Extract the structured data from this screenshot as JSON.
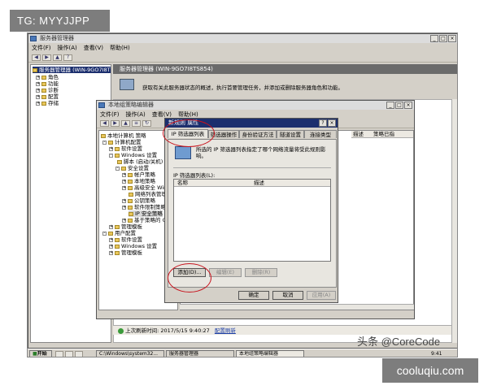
{
  "watermarks": {
    "tg": "TG: MYYJJPP",
    "toutiao": "头条 @CoreCode",
    "site": "cooluqiu.com"
  },
  "server_manager": {
    "title": "服务器管理器",
    "menu": [
      "文件(F)",
      "操作(A)",
      "查看(V)",
      "帮助(H)"
    ],
    "tree": [
      "服务器管理器 (WIN-9GO7I8TS854)",
      "角色",
      "功能",
      "诊断",
      "配置",
      "存储"
    ],
    "header": "服务器管理器 (WIN-9GO7I8TS854)",
    "desc": "获取有关此服务器状态的概述，执行首要管理任务，并添加或删除服务器角色和功能。",
    "status": "上次刷新时间: 2017/5/15 9:40:27",
    "refresh_link": "配置刷新"
  },
  "policy_editor": {
    "title": "本地组策略编辑器",
    "menu": [
      "文件(F)",
      "操作(A)",
      "查看(V)",
      "帮助(H)"
    ],
    "tree": [
      "本地计算机 策略",
      "计算机配置",
      "软件设置",
      "Windows 设置",
      "脚本 (启动/关机)",
      "安全设置",
      "帐户策略",
      "本地策略",
      "高级安全 Windows",
      "网络列表管理",
      "公钥策略",
      "软件限制策略",
      "IP 安全策略",
      "基于策略的 QoS",
      "管理模板",
      "用户配置",
      "软件设置",
      "Windows 设置",
      "管理模板"
    ],
    "right_header": "描述",
    "right_header2": "策略已指"
  },
  "dialog": {
    "title": "新规则 属性",
    "tabs": [
      "IP 筛选器列表",
      "筛选器操作",
      "身份验证方法",
      "隧道设置",
      "连接类型"
    ],
    "info": "所选的 IP 筛选器列表指定了哪个网络流量将受此规则影响。",
    "list_label": "IP 筛选器列表(L):",
    "columns": [
      "名称",
      "描述"
    ],
    "buttons": {
      "add": "添加(D)...",
      "edit": "编辑(E)",
      "remove": "删除(R)"
    },
    "footer": {
      "ok": "确定",
      "cancel": "取消",
      "apply": "应用(A)"
    }
  },
  "taskbar": {
    "start": "开始",
    "items": [
      "C:\\Windows\\system32...",
      "服务器管理器",
      "本地组策略编辑器"
    ],
    "clock": "9:41"
  }
}
